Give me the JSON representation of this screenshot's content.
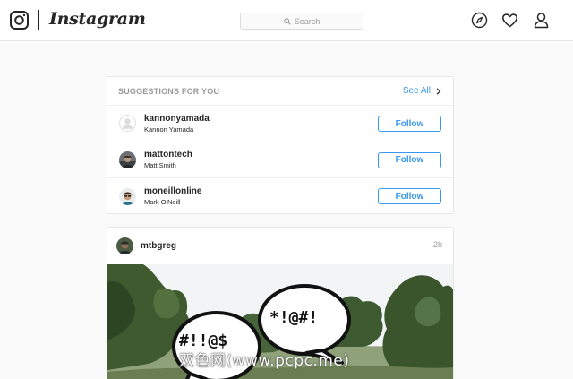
{
  "app": {
    "name": "Instagram"
  },
  "search": {
    "placeholder": "Search"
  },
  "nav_icons": [
    "compass-icon",
    "heart-icon",
    "profile-icon"
  ],
  "suggestions": {
    "title": "SUGGESTIONS FOR YOU",
    "see_all": "See All",
    "items": [
      {
        "username": "kannonyamada",
        "fullname": "Kannon Yamada",
        "button": "Follow",
        "avatar": "default-avatar"
      },
      {
        "username": "mattontech",
        "fullname": "Matt Smith",
        "button": "Follow",
        "avatar": "photo-avatar"
      },
      {
        "username": "moneillonline",
        "fullname": "Mark O'Neill",
        "button": "Follow",
        "avatar": "photo-avatar"
      }
    ]
  },
  "post": {
    "username": "mtbgreg",
    "time": "2h",
    "image": {
      "bubble_left": "#!!@$",
      "bubble_right": "*!@#!"
    }
  },
  "watermark": "双色网(www.pcpc.me)",
  "colors": {
    "accent": "#3897f0",
    "muted": "#999999",
    "text": "#262626",
    "border": "#e6e6e6",
    "page_bg": "#fafafa"
  }
}
